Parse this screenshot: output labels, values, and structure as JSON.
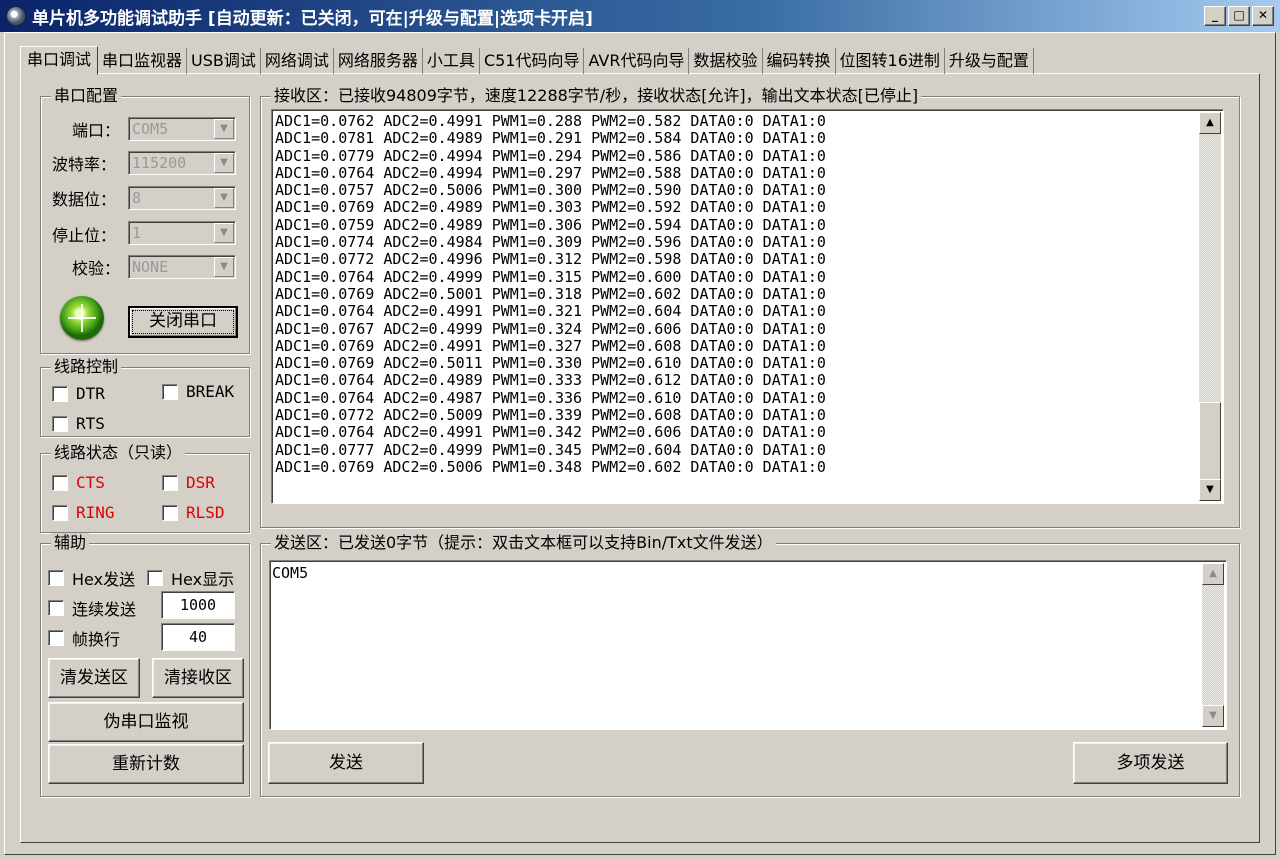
{
  "window": {
    "title": "单片机多功能调试助手 [自动更新：已关闭，可在|升级与配置|选项卡开启]",
    "minimize": "_",
    "maximize": "□",
    "close": "✕"
  },
  "tabs": [
    {
      "label": "串口调试",
      "active": true
    },
    {
      "label": "串口监视器"
    },
    {
      "label": "USB调试"
    },
    {
      "label": "网络调试"
    },
    {
      "label": "网络服务器"
    },
    {
      "label": "小工具"
    },
    {
      "label": "C51代码向导"
    },
    {
      "label": "AVR代码向导"
    },
    {
      "label": "数据校验"
    },
    {
      "label": "编码转换"
    },
    {
      "label": "位图转16进制"
    },
    {
      "label": "升级与配置"
    }
  ],
  "serial_config": {
    "title": "串口配置",
    "port": {
      "label": "端口：",
      "value": "COM5"
    },
    "baud": {
      "label": "波特率：",
      "value": "115200"
    },
    "data_bits": {
      "label": "数据位：",
      "value": "8"
    },
    "stop_bits": {
      "label": "停止位：",
      "value": "1"
    },
    "parity": {
      "label": "校验：",
      "value": "NONE"
    },
    "close_button": "关闭串口"
  },
  "line_control": {
    "title": "线路控制",
    "dtr": "DTR",
    "break": "BREAK",
    "rts": "RTS"
  },
  "line_status": {
    "title": "线路状态（只读）",
    "cts": "CTS",
    "dsr": "DSR",
    "ring": "RING",
    "rlsd": "RLSD"
  },
  "aux": {
    "title": "辅助",
    "hex_send": "Hex发送",
    "hex_display": "Hex显示",
    "continuous_send": "连续发送",
    "interval": "1000",
    "frame_newline": "帧换行",
    "frame_value": "40",
    "clear_send": "清发送区",
    "clear_receive": "清接收区",
    "pseudo_monitor": "伪串口监视",
    "recount": "重新计数"
  },
  "receive": {
    "title": "接收区：已接收94809字节，速度12288字节/秒，接收状态[允许]，输出文本状态[已停止]",
    "lines": [
      "ADC1=0.0762 ADC2=0.4991 PWM1=0.288 PWM2=0.582 DATA0:0 DATA1:0",
      "ADC1=0.0781 ADC2=0.4989 PWM1=0.291 PWM2=0.584 DATA0:0 DATA1:0",
      "ADC1=0.0779 ADC2=0.4994 PWM1=0.294 PWM2=0.586 DATA0:0 DATA1:0",
      "ADC1=0.0764 ADC2=0.4994 PWM1=0.297 PWM2=0.588 DATA0:0 DATA1:0",
      "ADC1=0.0757 ADC2=0.5006 PWM1=0.300 PWM2=0.590 DATA0:0 DATA1:0",
      "ADC1=0.0769 ADC2=0.4989 PWM1=0.303 PWM2=0.592 DATA0:0 DATA1:0",
      "ADC1=0.0759 ADC2=0.4989 PWM1=0.306 PWM2=0.594 DATA0:0 DATA1:0",
      "ADC1=0.0774 ADC2=0.4984 PWM1=0.309 PWM2=0.596 DATA0:0 DATA1:0",
      "ADC1=0.0772 ADC2=0.4996 PWM1=0.312 PWM2=0.598 DATA0:0 DATA1:0",
      "ADC1=0.0764 ADC2=0.4999 PWM1=0.315 PWM2=0.600 DATA0:0 DATA1:0",
      "ADC1=0.0769 ADC2=0.5001 PWM1=0.318 PWM2=0.602 DATA0:0 DATA1:0",
      "ADC1=0.0764 ADC2=0.4991 PWM1=0.321 PWM2=0.604 DATA0:0 DATA1:0",
      "ADC1=0.0767 ADC2=0.4999 PWM1=0.324 PWM2=0.606 DATA0:0 DATA1:0",
      "ADC1=0.0769 ADC2=0.4991 PWM1=0.327 PWM2=0.608 DATA0:0 DATA1:0",
      "ADC1=0.0769 ADC2=0.5011 PWM1=0.330 PWM2=0.610 DATA0:0 DATA1:0",
      "ADC1=0.0764 ADC2=0.4989 PWM1=0.333 PWM2=0.612 DATA0:0 DATA1:0",
      "ADC1=0.0764 ADC2=0.4987 PWM1=0.336 PWM2=0.610 DATA0:0 DATA1:0",
      "ADC1=0.0772 ADC2=0.5009 PWM1=0.339 PWM2=0.608 DATA0:0 DATA1:0",
      "ADC1=0.0764 ADC2=0.4991 PWM1=0.342 PWM2=0.606 DATA0:0 DATA1:0",
      "ADC1=0.0777 ADC2=0.4999 PWM1=0.345 PWM2=0.604 DATA0:0 DATA1:0",
      "ADC1=0.0769 ADC2=0.5006 PWM1=0.348 PWM2=0.602 DATA0:0 DATA1:0"
    ]
  },
  "send": {
    "title": "发送区：已发送0字节（提示：双击文本框可以支持Bin/Txt文件发送）",
    "text": "COM5",
    "send_button": "发送",
    "multi_send_button": "多项发送"
  },
  "icons": {
    "scroll_up": "▲",
    "scroll_down": "▼",
    "dropdown": "▼"
  }
}
